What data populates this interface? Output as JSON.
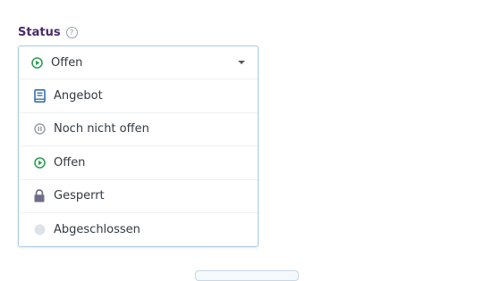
{
  "field": {
    "label": "Status",
    "help_icon": "question-circle-icon"
  },
  "select": {
    "selected_label": "Offen",
    "selected_icon": "play-circle-icon",
    "options": [
      {
        "label": "Angebot",
        "icon": "book-icon",
        "color": "#3a6da8"
      },
      {
        "label": "Noch nicht offen",
        "icon": "pause-circle-icon",
        "color": "#9aa0a6"
      },
      {
        "label": "Offen",
        "icon": "play-circle-icon",
        "color": "#2e9e56"
      },
      {
        "label": "Gesperrt",
        "icon": "lock-icon",
        "color": "#6e6e8a"
      },
      {
        "label": "Abgeschlossen",
        "icon": "circle-icon",
        "color": "#dfe3e8"
      }
    ]
  },
  "colors": {
    "label": "#4a2a6b",
    "border": "#a9cbe6",
    "accent_green": "#2e9e56"
  }
}
